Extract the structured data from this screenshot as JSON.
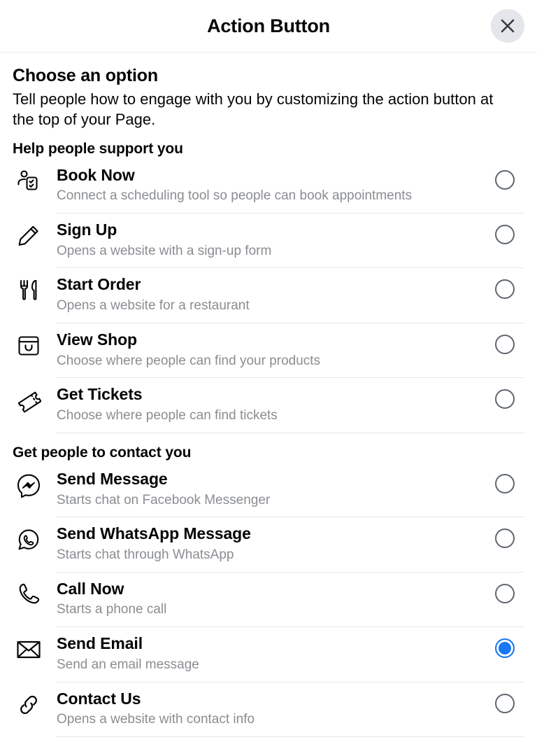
{
  "header": {
    "title": "Action Button",
    "close_icon": "close-icon"
  },
  "intro": {
    "title": "Choose an option",
    "description": "Tell people how to engage with you by customizing the action button at the top of your Page."
  },
  "colors": {
    "accent": "#1877f2",
    "text_primary": "#050505",
    "text_secondary": "#8a8d91",
    "divider": "#e4e6eb",
    "radio_border": "#606770",
    "close_bg": "#e4e6eb"
  },
  "groups": [
    {
      "heading": "Help people support you",
      "options": [
        {
          "label": "Book Now",
          "description": "Connect a scheduling tool so people can book appointments",
          "icon": "person-checklist-icon",
          "selected": false
        },
        {
          "label": "Sign Up",
          "description": "Opens a website with a sign-up form",
          "icon": "pencil-icon",
          "selected": false
        },
        {
          "label": "Start Order",
          "description": "Opens a website for a restaurant",
          "icon": "fork-knife-icon",
          "selected": false
        },
        {
          "label": "View Shop",
          "description": "Choose where people can find your products",
          "icon": "shopping-bag-icon",
          "selected": false
        },
        {
          "label": "Get Tickets",
          "description": "Choose where people can find tickets",
          "icon": "ticket-icon",
          "selected": false
        }
      ]
    },
    {
      "heading": "Get people to contact you",
      "options": [
        {
          "label": "Send Message",
          "description": "Starts chat on Facebook Messenger",
          "icon": "messenger-icon",
          "selected": false
        },
        {
          "label": "Send WhatsApp Message",
          "description": "Starts chat through WhatsApp",
          "icon": "whatsapp-icon",
          "selected": false
        },
        {
          "label": "Call Now",
          "description": "Starts a phone call",
          "icon": "phone-icon",
          "selected": false
        },
        {
          "label": "Send Email",
          "description": "Send an email message",
          "icon": "envelope-icon",
          "selected": true
        },
        {
          "label": "Contact Us",
          "description": "Opens a website with contact info",
          "icon": "link-icon",
          "selected": false
        }
      ]
    }
  ]
}
